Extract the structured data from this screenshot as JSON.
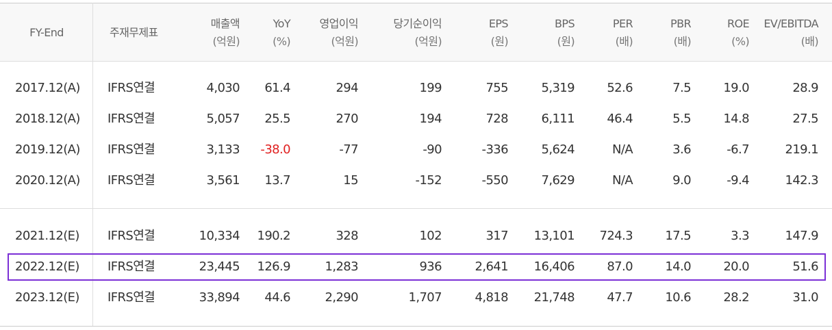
{
  "columns": [
    {
      "label": "FY-End",
      "unit": ""
    },
    {
      "label": "주재무제표",
      "unit": ""
    },
    {
      "label": "매출액",
      "unit": "(억원)"
    },
    {
      "label": "YoY",
      "unit": "(%)"
    },
    {
      "label": "영업이익",
      "unit": "(억원)"
    },
    {
      "label": "당기순이익",
      "unit": "(억원)"
    },
    {
      "label": "EPS",
      "unit": "(원)"
    },
    {
      "label": "BPS",
      "unit": "(원)"
    },
    {
      "label": "PER",
      "unit": "(배)"
    },
    {
      "label": "PBR",
      "unit": "(배)"
    },
    {
      "label": "ROE",
      "unit": "(%)"
    },
    {
      "label": "EV/EBITDA",
      "unit": "(배)"
    }
  ],
  "rows": [
    {
      "fy": "2017.12(A)",
      "basis": "IFRS연결",
      "sales": "4,030",
      "yoy": "61.4",
      "op": "294",
      "net": "199",
      "eps": "755",
      "bps": "5,319",
      "per": "52.6",
      "pbr": "7.5",
      "roe": "19.0",
      "ev": "28.9"
    },
    {
      "fy": "2018.12(A)",
      "basis": "IFRS연결",
      "sales": "5,057",
      "yoy": "25.5",
      "op": "270",
      "net": "194",
      "eps": "728",
      "bps": "6,111",
      "per": "46.4",
      "pbr": "5.5",
      "roe": "14.8",
      "ev": "27.5"
    },
    {
      "fy": "2019.12(A)",
      "basis": "IFRS연결",
      "sales": "3,133",
      "yoy": "-38.0",
      "op": "-77",
      "net": "-90",
      "eps": "-336",
      "bps": "5,624",
      "per": "N/A",
      "pbr": "3.6",
      "roe": "-6.7",
      "ev": "219.1"
    },
    {
      "fy": "2020.12(A)",
      "basis": "IFRS연결",
      "sales": "3,561",
      "yoy": "13.7",
      "op": "15",
      "net": "-152",
      "eps": "-550",
      "bps": "7,629",
      "per": "N/A",
      "pbr": "9.0",
      "roe": "-9.4",
      "ev": "142.3"
    },
    {
      "fy": "2021.12(E)",
      "basis": "IFRS연결",
      "sales": "10,334",
      "yoy": "190.2",
      "op": "328",
      "net": "102",
      "eps": "317",
      "bps": "13,101",
      "per": "724.3",
      "pbr": "17.5",
      "roe": "3.3",
      "ev": "147.9"
    },
    {
      "fy": "2022.12(E)",
      "basis": "IFRS연결",
      "sales": "23,445",
      "yoy": "126.9",
      "op": "1,283",
      "net": "936",
      "eps": "2,641",
      "bps": "16,406",
      "per": "87.0",
      "pbr": "14.0",
      "roe": "20.0",
      "ev": "51.6"
    },
    {
      "fy": "2023.12(E)",
      "basis": "IFRS연결",
      "sales": "33,894",
      "yoy": "44.6",
      "op": "2,290",
      "net": "1,707",
      "eps": "4,818",
      "bps": "21,748",
      "per": "47.7",
      "pbr": "10.6",
      "roe": "28.2",
      "ev": "31.0"
    }
  ],
  "highlighted_row": "2022.12(E)",
  "colors": {
    "negative": "#e02020",
    "highlight_border": "#7b2fd6",
    "header_bg": "#f8f8f8"
  }
}
